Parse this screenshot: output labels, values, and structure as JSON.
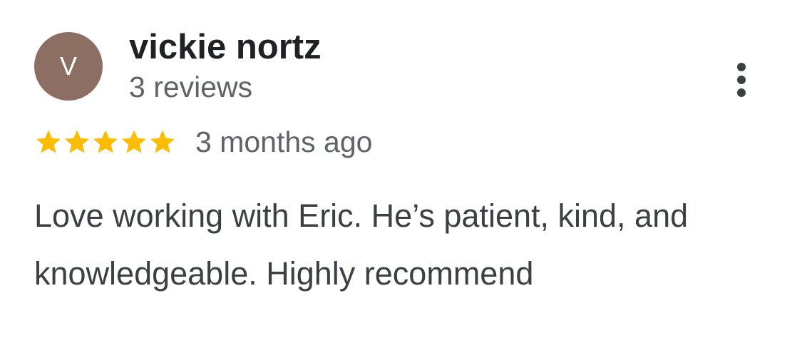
{
  "review": {
    "avatar_initial": "V",
    "avatar_color": "#8d6e63",
    "reviewer_name": "vickie nortz",
    "review_count": "3 reviews",
    "rating": 5,
    "rating_max": 5,
    "star_color": "#fbbc04",
    "time_ago": "3 months ago",
    "text": "Love working with Eric. He’s patient, kind, and knowledgeable. Highly recommend",
    "menu_icon": "more-vert-icon"
  }
}
